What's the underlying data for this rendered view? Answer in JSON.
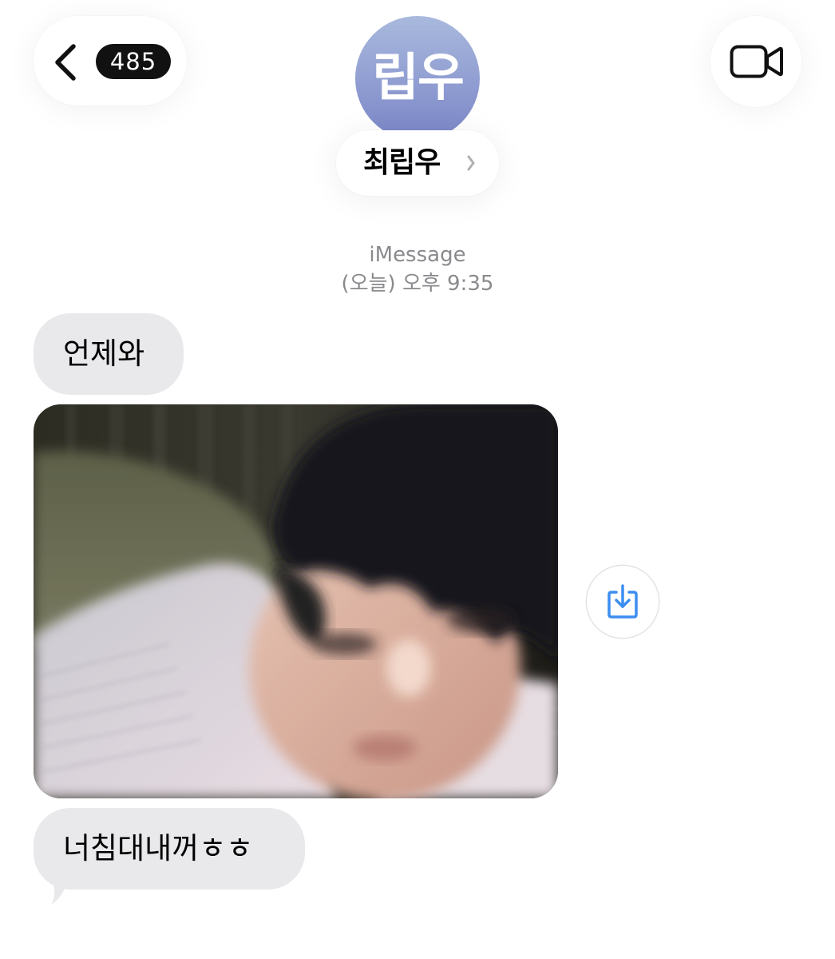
{
  "header": {
    "back_icon": "chevron-left-icon",
    "unread_count": "485",
    "avatar_initials": "립우",
    "contact_name": "최립우",
    "name_chevron_icon": "chevron-right-icon",
    "video_icon": "video-camera-icon"
  },
  "meta": {
    "service": "iMessage",
    "timestamp": "(오늘) 오후 9:35"
  },
  "messages": [
    {
      "type": "text",
      "direction": "incoming",
      "text": "언제와"
    },
    {
      "type": "photo",
      "direction": "incoming",
      "save_icon": "save-to-photos-icon"
    },
    {
      "type": "text",
      "direction": "incoming",
      "text": "너침대내꺼ㅎㅎ"
    }
  ],
  "colors": {
    "incoming_bubble": "#e9e9eb",
    "meta_text": "#8a8a8e",
    "accent_blue": "#3d8ef0",
    "badge_bg": "#111111",
    "avatar_top": "#a9b9dd",
    "avatar_bottom": "#7b86c8"
  }
}
